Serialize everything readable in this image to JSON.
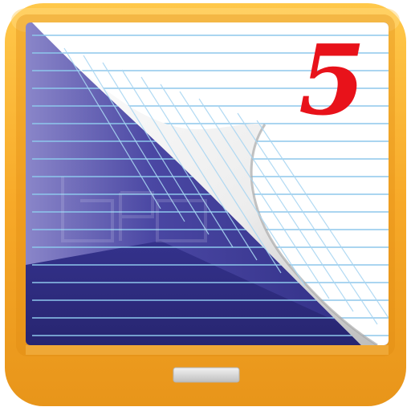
{
  "icon": {
    "digit": "5",
    "colors": {
      "frame_orange": "#F7A928",
      "frame_orange_light": "#FFD16A",
      "frame_orange_dark": "#E38E12",
      "screen_blue": "#2E2C82",
      "screen_blue_light": "#6461B5",
      "paper_white": "#FFFFFF",
      "paper_line_blue": "#8DC7EC",
      "digit_red": "#E8121A",
      "button_gray": "#D9D9D9"
    },
    "icons": [
      "tablet-frame",
      "notebook-page-curl",
      "home-button",
      "watermark-logo"
    ]
  }
}
